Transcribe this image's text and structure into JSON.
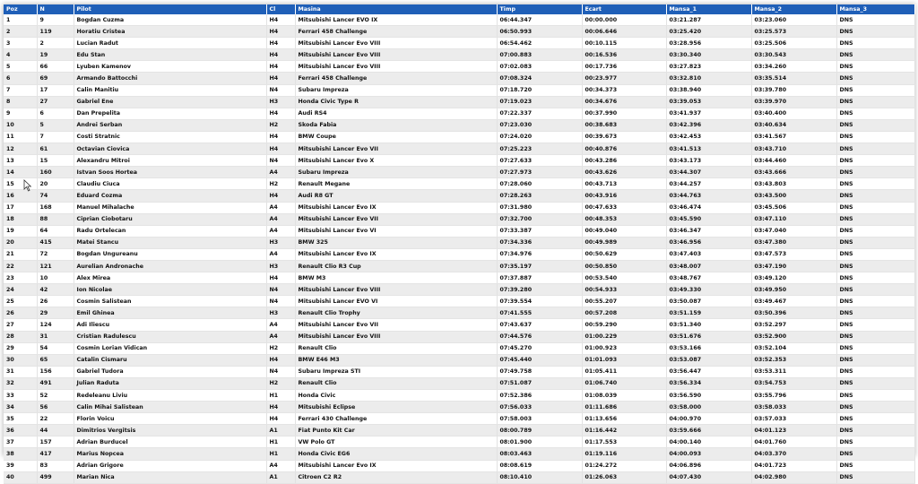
{
  "columns": [
    "Poz",
    "N",
    "Pilot",
    "Cl",
    "Masina",
    "Timp",
    "Ecart",
    "Mansa_1",
    "Mansa_2",
    "Mansa_3"
  ],
  "rows": [
    [
      "1",
      "9",
      "Bogdan Cuzma",
      "H4",
      "Mitsubishi Lancer EVO IX",
      "06:44.347",
      "00:00.000",
      "03:21.287",
      "03:23.060",
      "DNS"
    ],
    [
      "2",
      "119",
      "Horatiu Cristea",
      "H4",
      "Ferrari 458 Challenge",
      "06:50.993",
      "00:06.646",
      "03:25.420",
      "03:25.573",
      "DNS"
    ],
    [
      "3",
      "2",
      "Lucian Radut",
      "H4",
      "Mitsubishi Lancer Evo VIII",
      "06:54.462",
      "00:10.115",
      "03:28.956",
      "03:25.506",
      "DNS"
    ],
    [
      "4",
      "19",
      "Edu Stan",
      "H4",
      "Mitsubishi Lancer Evo VIII",
      "07:00.883",
      "00:16.536",
      "03:30.340",
      "03:30.543",
      "DNS"
    ],
    [
      "5",
      "66",
      "Lyuben Kamenov",
      "H4",
      "Mitsubishi Lancer Evo VIII",
      "07:02.083",
      "00:17.736",
      "03:27.823",
      "03:34.260",
      "DNS"
    ],
    [
      "6",
      "69",
      "Armando Battocchi",
      "H4",
      "Ferrari 458 Challenge",
      "07:08.324",
      "00:23.977",
      "03:32.810",
      "03:35.514",
      "DNS"
    ],
    [
      "7",
      "17",
      "Calin Manitiu",
      "N4",
      "Subaru Impreza",
      "07:18.720",
      "00:34.373",
      "03:38.940",
      "03:39.780",
      "DNS"
    ],
    [
      "8",
      "27",
      "Gabriel Ene",
      "H3",
      "Honda Civic Type R",
      "07:19.023",
      "00:34.676",
      "03:39.053",
      "03:39.970",
      "DNS"
    ],
    [
      "9",
      "6",
      "Dan Prepelita",
      "H4",
      "Audi RS4",
      "07:22.337",
      "00:37.990",
      "03:41.937",
      "03:40.400",
      "DNS"
    ],
    [
      "10",
      "5",
      "Andrei Serban",
      "H2",
      "Skoda Fabia",
      "07:23.030",
      "00:38.683",
      "03:42.396",
      "03:40.634",
      "DNS"
    ],
    [
      "11",
      "7",
      "Costi Stratnic",
      "H4",
      "BMW Coupe",
      "07:24.020",
      "00:39.673",
      "03:42.453",
      "03:41.567",
      "DNS"
    ],
    [
      "12",
      "61",
      "Octavian Ciovica",
      "H4",
      "Mitsubishi Lancer Evo VII",
      "07:25.223",
      "00:40.876",
      "03:41.513",
      "03:43.710",
      "DNS"
    ],
    [
      "13",
      "15",
      "Alexandru Mitroi",
      "N4",
      "Mitsubishi Lancer Evo X",
      "07:27.633",
      "00:43.286",
      "03:43.173",
      "03:44.460",
      "DNS"
    ],
    [
      "14",
      "160",
      "Istvan Soos Hortea",
      "A4",
      "Subaru Impreza",
      "07:27.973",
      "00:43.626",
      "03:44.307",
      "03:43.666",
      "DNS"
    ],
    [
      "15",
      "20",
      "Claudiu Ciuca",
      "H2",
      "Renault Megane",
      "07:28.060",
      "00:43.713",
      "03:44.257",
      "03:43.803",
      "DNS"
    ],
    [
      "16",
      "74",
      "Eduard Cozma",
      "H4",
      "Audi R8 GT",
      "07:28.263",
      "00:43.916",
      "03:44.763",
      "03:43.500",
      "DNS"
    ],
    [
      "17",
      "168",
      "Manuel Mihalache",
      "A4",
      "Mitsubishi Lancer Evo IX",
      "07:31.980",
      "00:47.633",
      "03:46.474",
      "03:45.506",
      "DNS"
    ],
    [
      "18",
      "88",
      "Ciprian Ciobotaru",
      "A4",
      "Mitsubishi Lancer Evo VII",
      "07:32.700",
      "00:48.353",
      "03:45.590",
      "03:47.110",
      "DNS"
    ],
    [
      "19",
      "64",
      "Radu Ortelecan",
      "A4",
      "Mitsubishi Lancer Evo VI",
      "07:33.387",
      "00:49.040",
      "03:46.347",
      "03:47.040",
      "DNS"
    ],
    [
      "20",
      "415",
      "Matei Stancu",
      "H3",
      "BMW 325",
      "07:34.336",
      "00:49.989",
      "03:46.956",
      "03:47.380",
      "DNS"
    ],
    [
      "21",
      "72",
      "Bogdan Ungureanu",
      "A4",
      "Mitsubishi Lancer Evo IX",
      "07:34.976",
      "00:50.629",
      "03:47.403",
      "03:47.573",
      "DNS"
    ],
    [
      "22",
      "121",
      "Aurelian Andronache",
      "H3",
      "Renault Clio R3 Cup",
      "07:35.197",
      "00:50.850",
      "03:48.007",
      "03:47.190",
      "DNS"
    ],
    [
      "23",
      "10",
      "Alex Mirea",
      "H4",
      "BMW M3",
      "07:37.887",
      "00:53.540",
      "03:48.767",
      "03:49.120",
      "DNS"
    ],
    [
      "24",
      "42",
      "Ion Nicolae",
      "N4",
      "Mitsubishi Lancer Evo VIII",
      "07:39.280",
      "00:54.933",
      "03:49.330",
      "03:49.950",
      "DNS"
    ],
    [
      "25",
      "26",
      "Cosmin Salistean",
      "N4",
      "Mitsubishi Lancer EVO VI",
      "07:39.554",
      "00:55.207",
      "03:50.087",
      "03:49.467",
      "DNS"
    ],
    [
      "26",
      "29",
      "Emil Ghinea",
      "H3",
      "Renault Clio Trophy",
      "07:41.555",
      "00:57.208",
      "03:51.159",
      "03:50.396",
      "DNS"
    ],
    [
      "27",
      "124",
      "Adi Iliescu",
      "A4",
      "Mitsubishi Lancer Evo VII",
      "07:43.637",
      "00:59.290",
      "03:51.340",
      "03:52.297",
      "DNS"
    ],
    [
      "28",
      "31",
      "Cristian Radulescu",
      "A4",
      "Mitsubishi Lancer Evo VIII",
      "07:44.576",
      "01:00.229",
      "03:51.676",
      "03:52.900",
      "DNS"
    ],
    [
      "29",
      "54",
      "Cosmin Lorian Vidican",
      "H2",
      "Renault Clio",
      "07:45.270",
      "01:00.923",
      "03:53.166",
      "03:52.104",
      "DNS"
    ],
    [
      "30",
      "65",
      "Catalin Cismaru",
      "H4",
      "BMW E46 M3",
      "07:45.440",
      "01:01.093",
      "03:53.087",
      "03:52.353",
      "DNS"
    ],
    [
      "31",
      "156",
      "Gabriel Tudora",
      "N4",
      "Subaru Impreza STI",
      "07:49.758",
      "01:05.411",
      "03:56.447",
      "03:53.311",
      "DNS"
    ],
    [
      "32",
      "491",
      "Julian Raduta",
      "H2",
      "Renault Clio",
      "07:51.087",
      "01:06.740",
      "03:56.334",
      "03:54.753",
      "DNS"
    ],
    [
      "33",
      "52",
      "Redeleanu Liviu",
      "H1",
      "Honda Civic",
      "07:52.386",
      "01:08.039",
      "03:56.590",
      "03:55.796",
      "DNS"
    ],
    [
      "34",
      "56",
      "Calin Mihai Salistean",
      "H4",
      "Mitsubishi Eclipse",
      "07:56.033",
      "01:11.686",
      "03:58.000",
      "03:58.033",
      "DNS"
    ],
    [
      "35",
      "22",
      "Florin Voicu",
      "H4",
      "Ferrari 430 Challenge",
      "07:58.003",
      "01:13.656",
      "04:00.970",
      "03:57.033",
      "DNS"
    ],
    [
      "36",
      "44",
      "Dimitrios Vergitsis",
      "A1",
      "Fiat Punto Kit Car",
      "08:00.789",
      "01:16.442",
      "03:59.666",
      "04:01.123",
      "DNS"
    ],
    [
      "37",
      "157",
      "Adrian Burducel",
      "H1",
      "VW Polo GT",
      "08:01.900",
      "01:17.553",
      "04:00.140",
      "04:01.760",
      "DNS"
    ],
    [
      "38",
      "417",
      "Marius Nopcea",
      "H1",
      "Honda Civic EG6",
      "08:03.463",
      "01:19.116",
      "04:00.093",
      "04:03.370",
      "DNS"
    ],
    [
      "39",
      "83",
      "Adrian Grigore",
      "A4",
      "Mitsubishi Lancer Evo IX",
      "08:08.619",
      "01:24.272",
      "04:06.896",
      "04:01.723",
      "DNS"
    ],
    [
      "40",
      "499",
      "Marian Nica",
      "A1",
      "Citroen C2 R2",
      "08:10.410",
      "01:26.063",
      "04:07.430",
      "04:02.980",
      "DNS"
    ]
  ],
  "theme": {
    "header_bg": "#1f5fb8",
    "header_fg": "#ffffff",
    "stripe": "#ececec"
  }
}
